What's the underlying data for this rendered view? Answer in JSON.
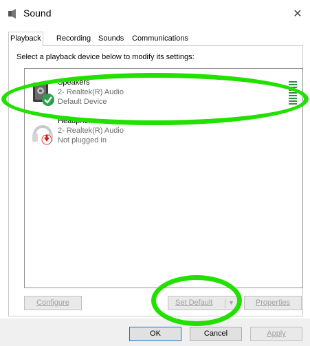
{
  "window": {
    "title": "Sound",
    "close_symbol": "✕"
  },
  "tabs": [
    {
      "label": "Playback",
      "active": true
    },
    {
      "label": "Recording",
      "active": false
    },
    {
      "label": "Sounds",
      "active": false
    },
    {
      "label": "Communications",
      "active": false
    }
  ],
  "instruction": "Select a playback device below to modify its settings:",
  "devices": [
    {
      "name": "Speakers",
      "driver": "2- Realtek(R) Audio",
      "status": "Default Device",
      "icon": "speaker-icon",
      "badge": "green-check"
    },
    {
      "name": "Headphone",
      "driver": "2- Realtek(R) Audio",
      "status": "Not plugged in",
      "icon": "headphone-icon",
      "badge": "red-down-arrow"
    }
  ],
  "buttons": {
    "configure": "Configure",
    "set_default": "Set Default",
    "properties": "Properties",
    "ok": "OK",
    "cancel": "Cancel",
    "apply": "Apply"
  },
  "colors": {
    "annotation": "#22e000",
    "accent": "#0078d7"
  }
}
